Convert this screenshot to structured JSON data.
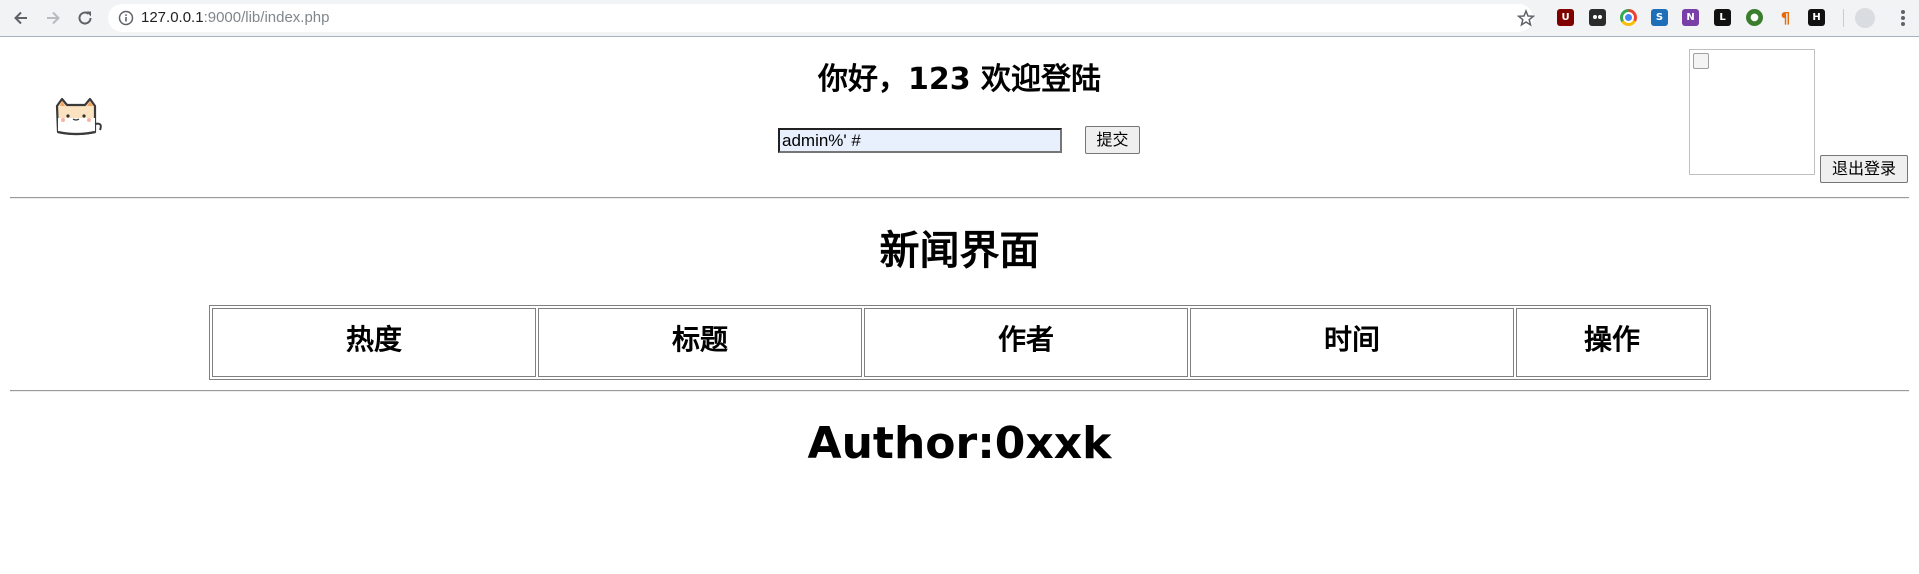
{
  "browser": {
    "url_host": "127.0.0.1",
    "url_rest": ":9000/lib/index.php"
  },
  "page": {
    "greeting": "你好，123 欢迎登陆",
    "search_value": "admin%' #",
    "submit_label": "提交",
    "logout_label": "退出登录",
    "news_title": "新闻界面",
    "table_headers": [
      "热度",
      "标题",
      "作者",
      "时间",
      "操作"
    ],
    "author": "Author:0xxk"
  },
  "colors": {
    "toolbar_bg": "#f1f3f4",
    "input_autofill_bg": "#e8f0fe"
  },
  "icons": [
    "back-arrow-icon",
    "forward-arrow-icon",
    "reload-icon",
    "info-icon",
    "bookmark-star-icon",
    "cat-logo-icon",
    "broken-image-icon"
  ]
}
